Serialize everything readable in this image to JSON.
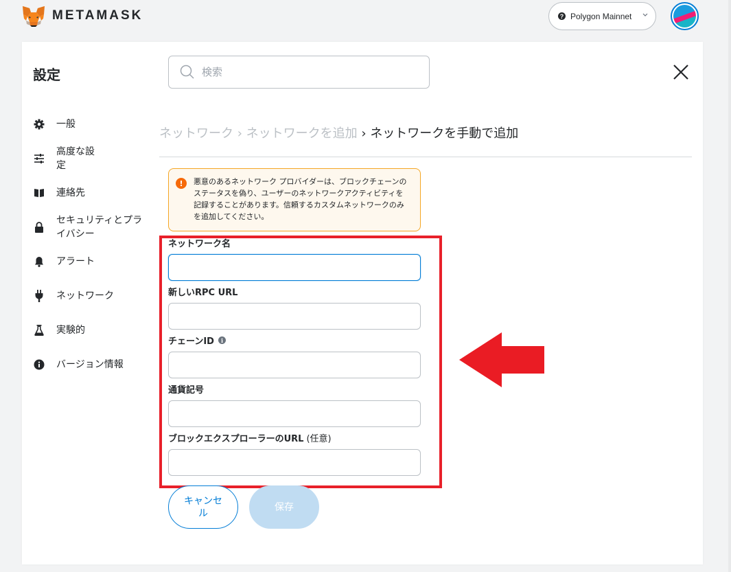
{
  "header": {
    "brand": "METAMASK",
    "network": "Polygon Mainnet",
    "network_icon": "?"
  },
  "settings": {
    "title": "設定",
    "search_placeholder": "検索"
  },
  "sidebar": {
    "items": [
      {
        "label": "一般",
        "icon": "gear-icon"
      },
      {
        "label": "高度な設定",
        "icon": "sliders-icon"
      },
      {
        "label": "連絡先",
        "icon": "book-icon"
      },
      {
        "label": "セキュリティとプライバシー",
        "icon": "lock-icon"
      },
      {
        "label": "アラート",
        "icon": "bell-icon"
      },
      {
        "label": "ネットワーク",
        "icon": "plug-icon"
      },
      {
        "label": "実験的",
        "icon": "flask-icon"
      },
      {
        "label": "バージョン情報",
        "icon": "info-icon"
      }
    ]
  },
  "breadcrumb": {
    "part1": "ネットワーク",
    "sep1": " › ",
    "part2": "ネットワークを追加",
    "sep2": " › ",
    "part3": "ネットワークを手動で追加"
  },
  "warning": {
    "text": "悪意のあるネットワーク プロバイダーは、ブロックチェーンのステータスを偽り、ユーザーのネットワークアクティビティを記録することがあります。信頼するカスタムネットワークのみを追加してください。"
  },
  "form": {
    "network_name_label": "ネットワーク名",
    "rpc_url_label": "新しいRPC URL",
    "chain_id_label": "チェーンID",
    "currency_symbol_label": "通貨記号",
    "explorer_url_label": "ブロックエクスプローラーのURL",
    "explorer_url_optional": "(任意)",
    "network_name_value": "",
    "rpc_url_value": "",
    "chain_id_value": "",
    "currency_symbol_value": "",
    "explorer_url_value": ""
  },
  "buttons": {
    "cancel": "キャンセル",
    "save": "保存"
  },
  "colors": {
    "accent": "#037dd6",
    "highlight": "#e8202a",
    "warning_icon": "#f66a0a"
  }
}
